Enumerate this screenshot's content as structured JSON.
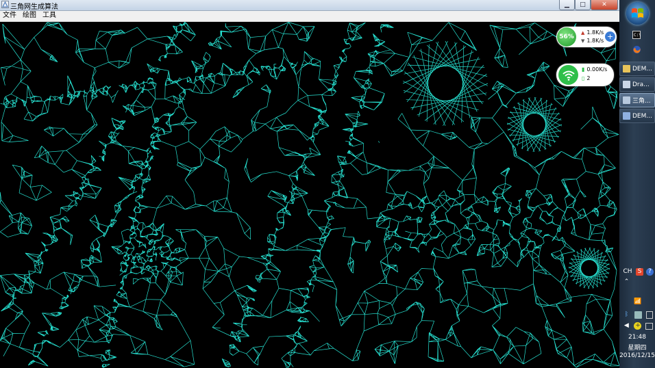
{
  "window": {
    "title": "三角网生成算法",
    "minimize": "▁",
    "maximize": "□",
    "close": "✕"
  },
  "menu": [
    "文件",
    "绘图",
    "工具"
  ],
  "net_widget": {
    "cpu_percent": "56%",
    "upload": "1.8K/s",
    "download": "1.8K/s",
    "plus": "+"
  },
  "wifi_widget": {
    "speed": "0.00K/s",
    "devices": "2"
  },
  "taskbar": {
    "quick_launch": [
      "terminal-icon",
      "firefox-icon"
    ],
    "tasks": [
      {
        "label": "DEM...",
        "icon": "folder-icon",
        "color": "#e8c45a",
        "active": false
      },
      {
        "label": "Dra...",
        "icon": "draw-app-icon",
        "color": "#c9d6e6",
        "active": false
      },
      {
        "label": "三角...",
        "icon": "triangle-app-icon",
        "color": "#b7c9de",
        "active": true
      },
      {
        "label": "DEM...",
        "icon": "vs-app-icon",
        "color": "#8fb0e0",
        "active": false
      }
    ],
    "tray": {
      "lang": "CH",
      "time": "21:48",
      "weekday": "星期四",
      "date": "2016/12/15"
    }
  },
  "colors": {
    "mesh": "#27e3d3",
    "canvas_bg": "#000000",
    "cpu_green": "#2fbf4a"
  }
}
